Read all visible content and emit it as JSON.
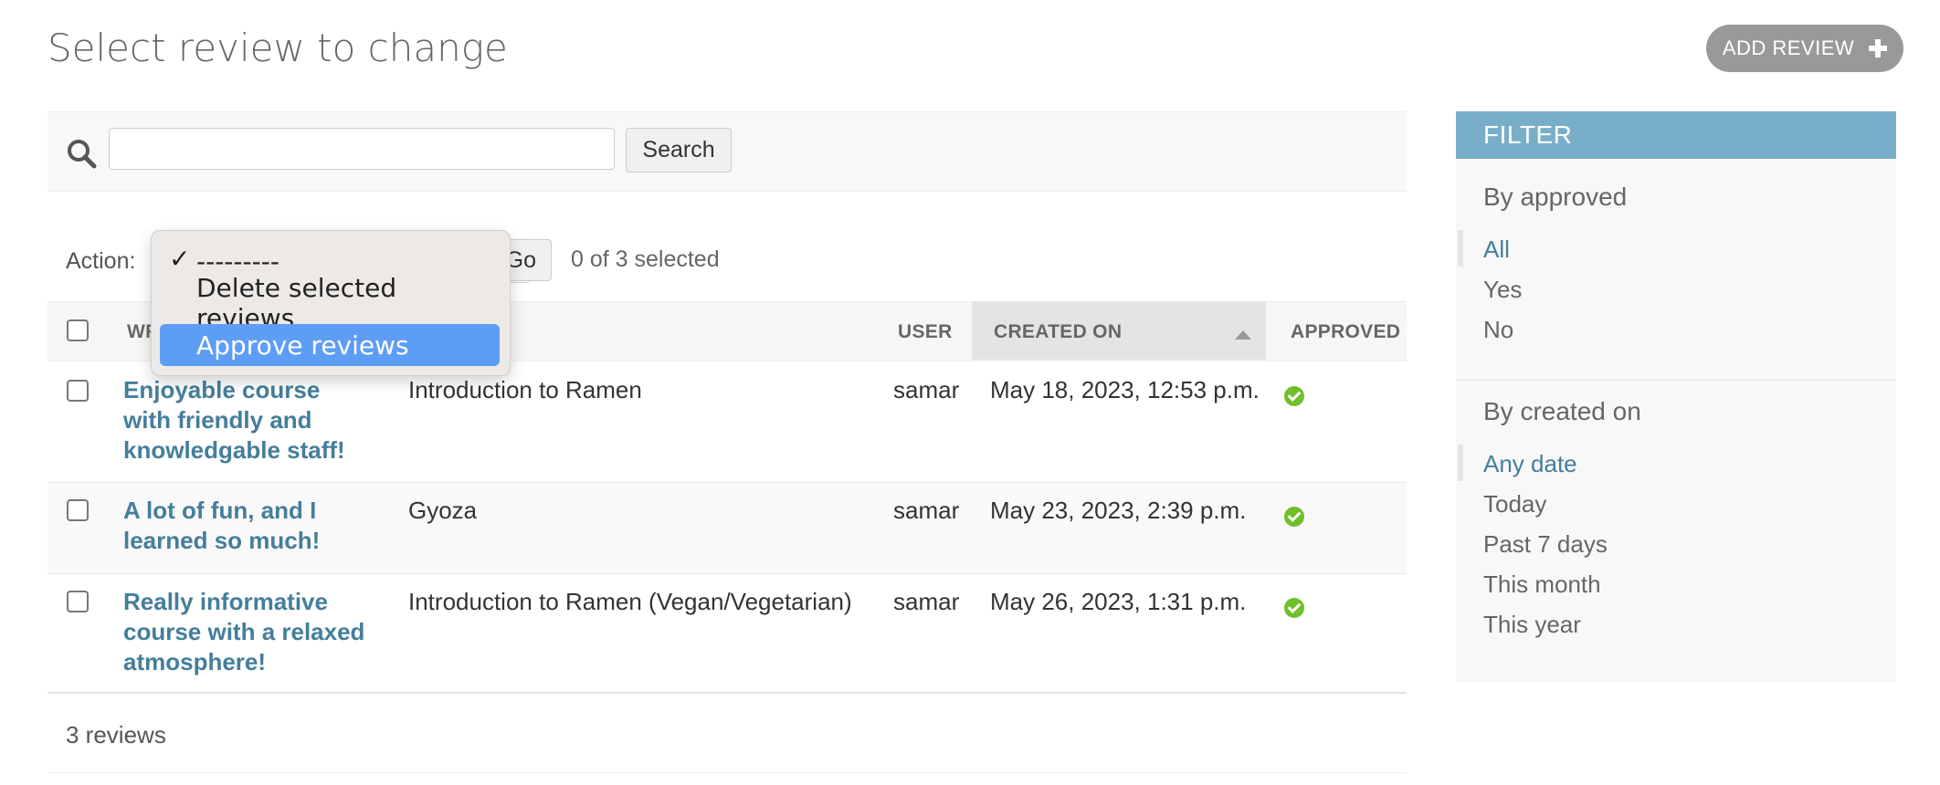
{
  "page": {
    "title": "Select review to change",
    "add_button_label": "ADD REVIEW"
  },
  "search": {
    "placeholder": "",
    "value": "",
    "button_label": "Search"
  },
  "actions": {
    "label": "Action:",
    "go_label": "Go",
    "selected_text": "0 of 3 selected",
    "options": [
      "---------",
      "Delete selected reviews",
      "Approve reviews"
    ],
    "checked_option": "---------",
    "highlighted_option": "Approve reviews"
  },
  "table": {
    "headers": {
      "review": "WR",
      "user": "USER",
      "created_on": "CREATED ON",
      "approved": "APPROVED"
    },
    "rows": [
      {
        "review": "Enjoyable course with friendly and knowledgable staff!",
        "course": "Introduction to Ramen",
        "user": "samar",
        "created_on": "May 18, 2023, 12:53 p.m.",
        "approved": true
      },
      {
        "review": "A lot of fun, and I learned so much!",
        "course": "Gyoza",
        "user": "samar",
        "created_on": "May 23, 2023, 2:39 p.m.",
        "approved": true
      },
      {
        "review": "Really informative course with a relaxed atmosphere!",
        "course": "Introduction to Ramen (Vegan/Vegetarian)",
        "user": "samar",
        "created_on": "May 26, 2023, 1:31 p.m.",
        "approved": true
      }
    ],
    "result_count": "3 reviews"
  },
  "filter": {
    "title": "FILTER",
    "sections": [
      {
        "title": "By approved",
        "items": [
          "All",
          "Yes",
          "No"
        ],
        "active": "All"
      },
      {
        "title": "By created on",
        "items": [
          "Any date",
          "Today",
          "Past 7 days",
          "This month",
          "This year"
        ],
        "active": "Any date"
      }
    ]
  },
  "colors": {
    "link": "#447e9b",
    "filter_header": "#79aec8",
    "approved_icon": "#70bf2b",
    "dropdown_highlight": "#5e9df6",
    "add_button": "#999999"
  },
  "icons": {
    "search": "search-icon",
    "add": "plus-icon",
    "approved": "check-circle-icon",
    "sort": "sort-ascending-icon",
    "checkmark": "checkmark-icon"
  }
}
